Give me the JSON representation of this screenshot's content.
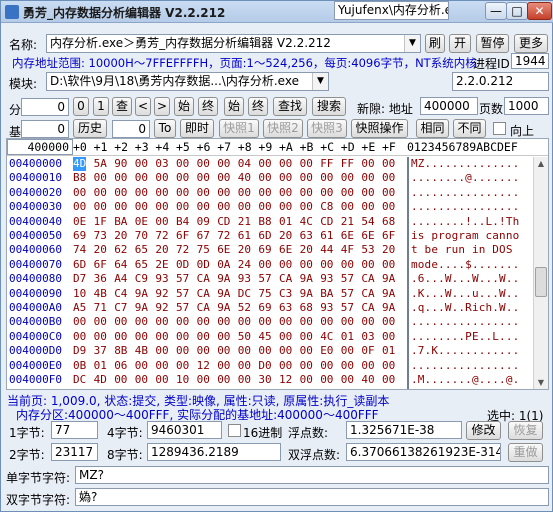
{
  "window": {
    "title": "勇芳_内存数据分析编辑器 V2.2.212",
    "minimize": "—",
    "maximize": "□",
    "close": "✕"
  },
  "row1": {
    "name_label": "名称:",
    "name_value": "内存分析.exe＞勇芳_内存数据分析编辑器 V2.2.212",
    "refresh_button": "刷",
    "open_button": "开",
    "pause_button": "暂停",
    "more_button": "更多"
  },
  "info": {
    "address_range": "内存地址范围: 10000H～7FFEFFFFH，页面:1～524,256，每页:4096字节，NT系统内核",
    "pid_label": "进程ID:",
    "pid_value": "1944"
  },
  "module": {
    "label": "模块:",
    "path_value": "D:\\软件\\9月\\18\\勇芳内存数据...\\内存分析.exe",
    "company_value": "Yujufenx\\内存分析.exe",
    "version_value": "2.2.0.212"
  },
  "nav": {
    "seg_label": "分",
    "seg_value": "0",
    "btn_zero": "0",
    "btn_one": "1",
    "btn_find": "查",
    "btn_prev": "<",
    "btn_next": ">",
    "btn_start": "始",
    "btn_end": "终",
    "btn_start2": "始",
    "btn_end2": "终",
    "btn_search": "查找",
    "btn_search2": "搜索",
    "new_addr_label": "新隙: 地址",
    "new_addr_value": "400000",
    "page_label": "页数",
    "page_value": "1000",
    "base_label": "基",
    "base_value": "0",
    "history_button": "历史",
    "history_value": "0",
    "to_button": "To",
    "realtime_button": "即时",
    "snap1_button": "快照1",
    "snap2_button": "快照2",
    "snap3_button": "快照3",
    "snap_op_button": "快照操作",
    "same_button": "相同",
    "diff_button": "不同",
    "upward_label": "向上"
  },
  "hex": {
    "address_head": "400000",
    "columns": [
      "+0",
      "+1",
      "+2",
      "+3",
      "+4",
      "+5",
      "+6",
      "+7",
      "+8",
      "+9",
      "+A",
      "+B",
      "+C",
      "+D",
      "+E",
      "+F"
    ],
    "ascii_head": "0123456789ABCDEF",
    "rows": [
      {
        "addr": "00400000",
        "bytes": [
          "4D",
          "5A",
          "90",
          "00",
          "03",
          "00",
          "00",
          "00",
          "04",
          "00",
          "00",
          "00",
          "FF",
          "FF",
          "00",
          "00"
        ],
        "ascii": "MZ.............."
      },
      {
        "addr": "00400010",
        "bytes": [
          "B8",
          "00",
          "00",
          "00",
          "00",
          "00",
          "00",
          "00",
          "40",
          "00",
          "00",
          "00",
          "00",
          "00",
          "00",
          "00"
        ],
        "ascii": "........@......."
      },
      {
        "addr": "00400020",
        "bytes": [
          "00",
          "00",
          "00",
          "00",
          "00",
          "00",
          "00",
          "00",
          "00",
          "00",
          "00",
          "00",
          "00",
          "00",
          "00",
          "00"
        ],
        "ascii": "................"
      },
      {
        "addr": "00400030",
        "bytes": [
          "00",
          "00",
          "00",
          "00",
          "00",
          "00",
          "00",
          "00",
          "00",
          "00",
          "00",
          "00",
          "C8",
          "00",
          "00",
          "00"
        ],
        "ascii": "................"
      },
      {
        "addr": "00400040",
        "bytes": [
          "0E",
          "1F",
          "BA",
          "0E",
          "00",
          "B4",
          "09",
          "CD",
          "21",
          "B8",
          "01",
          "4C",
          "CD",
          "21",
          "54",
          "68"
        ],
        "ascii": "........!..L.!Th"
      },
      {
        "addr": "00400050",
        "bytes": [
          "69",
          "73",
          "20",
          "70",
          "72",
          "6F",
          "67",
          "72",
          "61",
          "6D",
          "20",
          "63",
          "61",
          "6E",
          "6E",
          "6F"
        ],
        "ascii": "is program canno"
      },
      {
        "addr": "00400060",
        "bytes": [
          "74",
          "20",
          "62",
          "65",
          "20",
          "72",
          "75",
          "6E",
          "20",
          "69",
          "6E",
          "20",
          "44",
          "4F",
          "53",
          "20"
        ],
        "ascii": "t be run in DOS "
      },
      {
        "addr": "00400070",
        "bytes": [
          "6D",
          "6F",
          "64",
          "65",
          "2E",
          "0D",
          "0D",
          "0A",
          "24",
          "00",
          "00",
          "00",
          "00",
          "00",
          "00",
          "00"
        ],
        "ascii": "mode....$......."
      },
      {
        "addr": "00400080",
        "bytes": [
          "D7",
          "36",
          "A4",
          "C9",
          "93",
          "57",
          "CA",
          "9A",
          "93",
          "57",
          "CA",
          "9A",
          "93",
          "57",
          "CA",
          "9A"
        ],
        "ascii": ".6...W...W...W.."
      },
      {
        "addr": "00400090",
        "bytes": [
          "10",
          "4B",
          "C4",
          "9A",
          "92",
          "57",
          "CA",
          "9A",
          "DC",
          "75",
          "C3",
          "9A",
          "BA",
          "57",
          "CA",
          "9A"
        ],
        "ascii": ".K...W...u...W.."
      },
      {
        "addr": "004000A0",
        "bytes": [
          "A5",
          "71",
          "C7",
          "9A",
          "92",
          "57",
          "CA",
          "9A",
          "52",
          "69",
          "63",
          "68",
          "93",
          "57",
          "CA",
          "9A"
        ],
        "ascii": ".q...W..Rich.W.."
      },
      {
        "addr": "004000B0",
        "bytes": [
          "00",
          "00",
          "00",
          "00",
          "00",
          "00",
          "00",
          "00",
          "00",
          "00",
          "00",
          "00",
          "00",
          "00",
          "00",
          "00"
        ],
        "ascii": "................"
      },
      {
        "addr": "004000C0",
        "bytes": [
          "00",
          "00",
          "00",
          "00",
          "00",
          "00",
          "00",
          "00",
          "50",
          "45",
          "00",
          "00",
          "4C",
          "01",
          "03",
          "00"
        ],
        "ascii": "........PE..L..."
      },
      {
        "addr": "004000D0",
        "bytes": [
          "D9",
          "37",
          "8B",
          "4B",
          "00",
          "00",
          "00",
          "00",
          "00",
          "00",
          "00",
          "00",
          "E0",
          "00",
          "0F",
          "01"
        ],
        "ascii": ".7.K............"
      },
      {
        "addr": "004000E0",
        "bytes": [
          "0B",
          "01",
          "06",
          "00",
          "00",
          "00",
          "12",
          "00",
          "00",
          "D0",
          "00",
          "00",
          "00",
          "00",
          "00",
          "00"
        ],
        "ascii": "................"
      },
      {
        "addr": "004000F0",
        "bytes": [
          "DC",
          "4D",
          "00",
          "00",
          "00",
          "10",
          "00",
          "00",
          "00",
          "30",
          "12",
          "00",
          "00",
          "00",
          "40",
          "00"
        ],
        "ascii": ".M.......@....@."
      }
    ]
  },
  "status": {
    "line1": "当前页: 1,009.0, 状态:提交, 类型:映像, 属性:只读, 原属性:执行_读副本",
    "line2": "内存分区:400000～400FFF, 实际分配的基地址:400000～400FFF",
    "selected": "选中: 1(1)"
  },
  "values": {
    "byte1_label": "1字节:",
    "byte1_value": "77",
    "byte4_label": "4字节:",
    "byte4_value": "9460301",
    "hex16_label": "16进制",
    "float_label": "浮点数:",
    "float_value": "1.325671E-38",
    "modify_button": "修改",
    "restore_button": "恢复",
    "byte2_label": "2字节:",
    "byte2_value": "23117",
    "byte8_label": "8字节:",
    "byte8_value": "1289436.2189",
    "double_label": "双浮点数:",
    "double_value": "6.37066138261923E-314",
    "reset_button": "重做",
    "single_str_label": "单字节字符:",
    "single_str_value": "MZ?",
    "double_str_label": "双字节字符:",
    "double_str_value": "媯?"
  },
  "colors": {
    "address": "#0000b4",
    "hex_bytes": "#8b0000",
    "selection": "#3399ff",
    "status_text": "#0000c8"
  }
}
